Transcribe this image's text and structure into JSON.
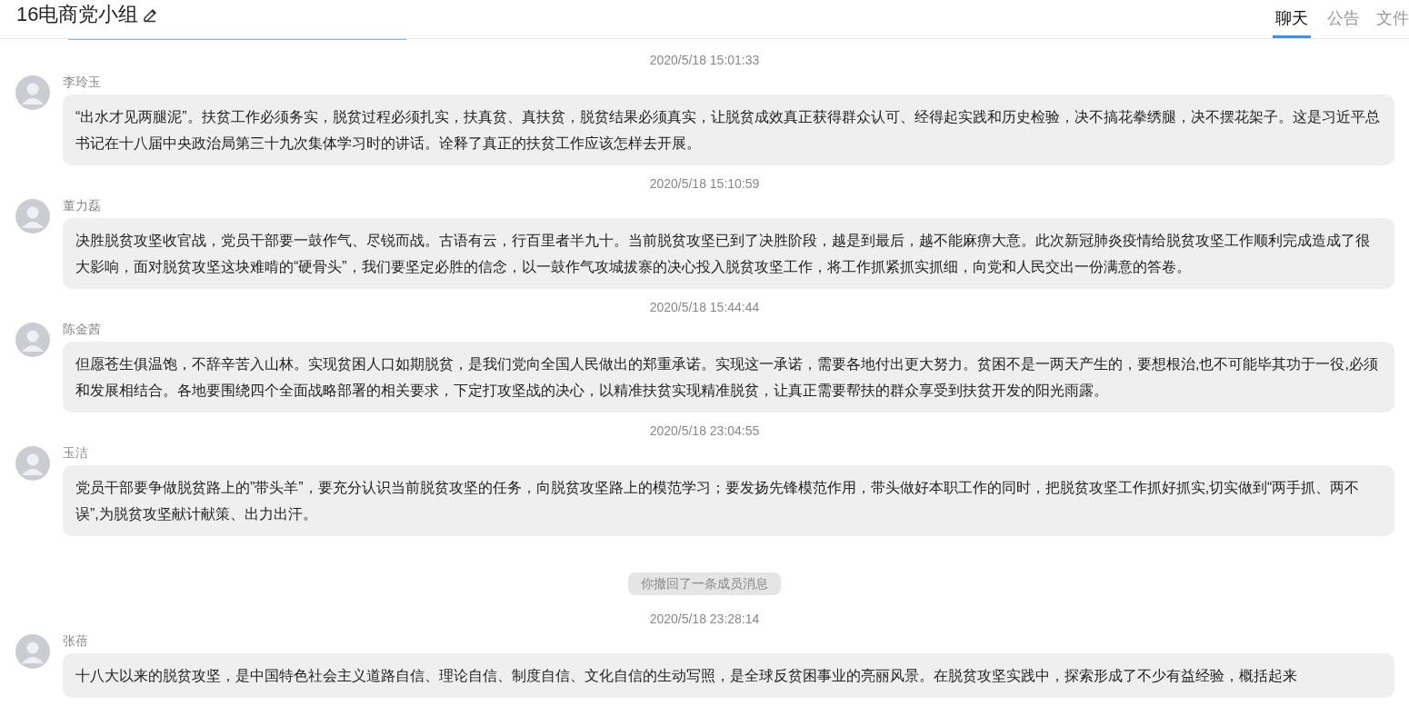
{
  "header": {
    "title": "16电商党小组",
    "tabs": [
      {
        "label": "聊天",
        "selected": true
      },
      {
        "label": "公告",
        "selected": false
      },
      {
        "label": "文件",
        "selected": false
      }
    ]
  },
  "messages": [
    {
      "kind": "message",
      "time": "2020/5/18 15:01:33",
      "sender": "李玲玉",
      "text": "“出水才见两腿泥”。扶贫工作必须务实，脱贫过程必须扎实，扶真贫、真扶贫，脱贫结果必须真实，让脱贫成效真正获得群众认可、经得起实践和历史检验，决不搞花拳绣腿，决不摆花架子。这是习近平总书记在十八届中央政治局第三十九次集体学习时的讲话。诠释了真正的扶贫工作应该怎样去开展。"
    },
    {
      "kind": "message",
      "time": "2020/5/18 15:10:59",
      "sender": "董力磊",
      "text": "决胜脱贫攻坚收官战，党员干部要一鼓作气、尽锐而战。古语有云，行百里者半九十。当前脱贫攻坚已到了决胜阶段，越是到最后，越不能麻痹大意。此次新冠肺炎疫情给脱贫攻坚工作顺利完成造成了很大影响，面对脱贫攻坚这块难啃的“硬骨头”，我们要坚定必胜的信念，以一鼓作气攻城拔寨的决心投入脱贫攻坚工作，将工作抓紧抓实抓细，向党和人民交出一份满意的答卷。"
    },
    {
      "kind": "message",
      "time": "2020/5/18 15:44:44",
      "sender": "陈金茜",
      "text": "但愿苍生俱温饱，不辞辛苦入山林。实现贫困人口如期脱贫，是我们党向全国人民做出的郑重承诺。实现这一承诺，需要各地付出更大努力。贫困不是一两天产生的，要想根治,也不可能毕其功于一役,必须和发展相结合。各地要围绕四个全面战略部署的相关要求，下定打攻坚战的决心，以精准扶贫实现精准脱贫，让真正需要帮扶的群众享受到扶贫开发的阳光雨露。"
    },
    {
      "kind": "message",
      "time": "2020/5/18 23:04:55",
      "sender": "玉洁",
      "text": "党员干部要争做脱贫路上的”带头羊”，要充分认识当前脱贫攻坚的任务，向脱贫攻坚路上的模范学习；要发扬先锋模范作用，带头做好本职工作的同时，把脱贫攻坚工作抓好抓实,切实做到“两手抓、两不误”,为脱贫攻坚献计献策、出力出汗。"
    },
    {
      "kind": "notice",
      "text": "你撤回了一条成员消息"
    },
    {
      "kind": "message",
      "time": "2020/5/18 23:28:14",
      "sender": "张蓓",
      "text": "十八大以来的脱贫攻坚，是中国特色社会主义道路自信、理论自信、制度自信、文化自信的生动写照，是全球反贫困事业的亮丽风景。在脱贫攻坚实践中，探索形成了不少有益经验，概括起来"
    }
  ]
}
